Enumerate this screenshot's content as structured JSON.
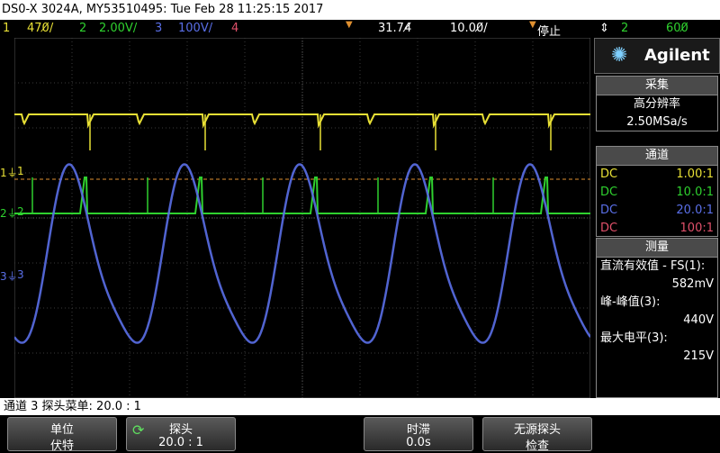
{
  "title": "DS0-X 3024A, MY53510495: Tue Feb 28 11:25:15 2017",
  "channels": [
    {
      "num": "1",
      "scale": "470̸/",
      "color": "#e8e035"
    },
    {
      "num": "2",
      "scale": "2.00V/",
      "color": "#2fd12f"
    },
    {
      "num": "3",
      "scale": "100V/",
      "color": "#5a6fe8"
    },
    {
      "num": "4",
      "scale": "",
      "color": "#e0506a"
    }
  ],
  "timebase": {
    "delay": "31.74̸",
    "scale": "10.00̸/",
    "state": "停止",
    "trig_src": "2",
    "trig_level": "600̸"
  },
  "brand": "Agilent",
  "acquire": {
    "header": "采集",
    "mode": "高分辨率",
    "rate": "2.50MSa/s"
  },
  "channels_panel": {
    "header": "通道",
    "rows": [
      {
        "coupling": "DC",
        "ratio": "1.00:1",
        "color": "#e8e035"
      },
      {
        "coupling": "DC",
        "ratio": "10.0:1",
        "color": "#2fd12f"
      },
      {
        "coupling": "DC",
        "ratio": "20.0:1",
        "color": "#5a6fe8"
      },
      {
        "coupling": "DC",
        "ratio": "100:1",
        "color": "#e0506a"
      }
    ]
  },
  "measure": {
    "header": "测量",
    "items": [
      {
        "label": "直流有效值 - FS(1):",
        "value": "582mV"
      },
      {
        "label": "峰-峰值(3):",
        "value": "440V"
      },
      {
        "label": "最大电平(3):",
        "value": "215V"
      }
    ]
  },
  "status_line": "通道 3 探头菜单: 20.0 : 1",
  "softkeys": [
    {
      "title": "单位",
      "value": "伏特"
    },
    {
      "title": "探头",
      "value": "20.0 : 1"
    },
    {
      "title": "时滞",
      "value": "0.0s"
    },
    {
      "title": "无源探头",
      "value": "检查"
    }
  ],
  "markers": {
    "ch1": "1",
    "ch2": "2",
    "ch3": "3"
  }
}
